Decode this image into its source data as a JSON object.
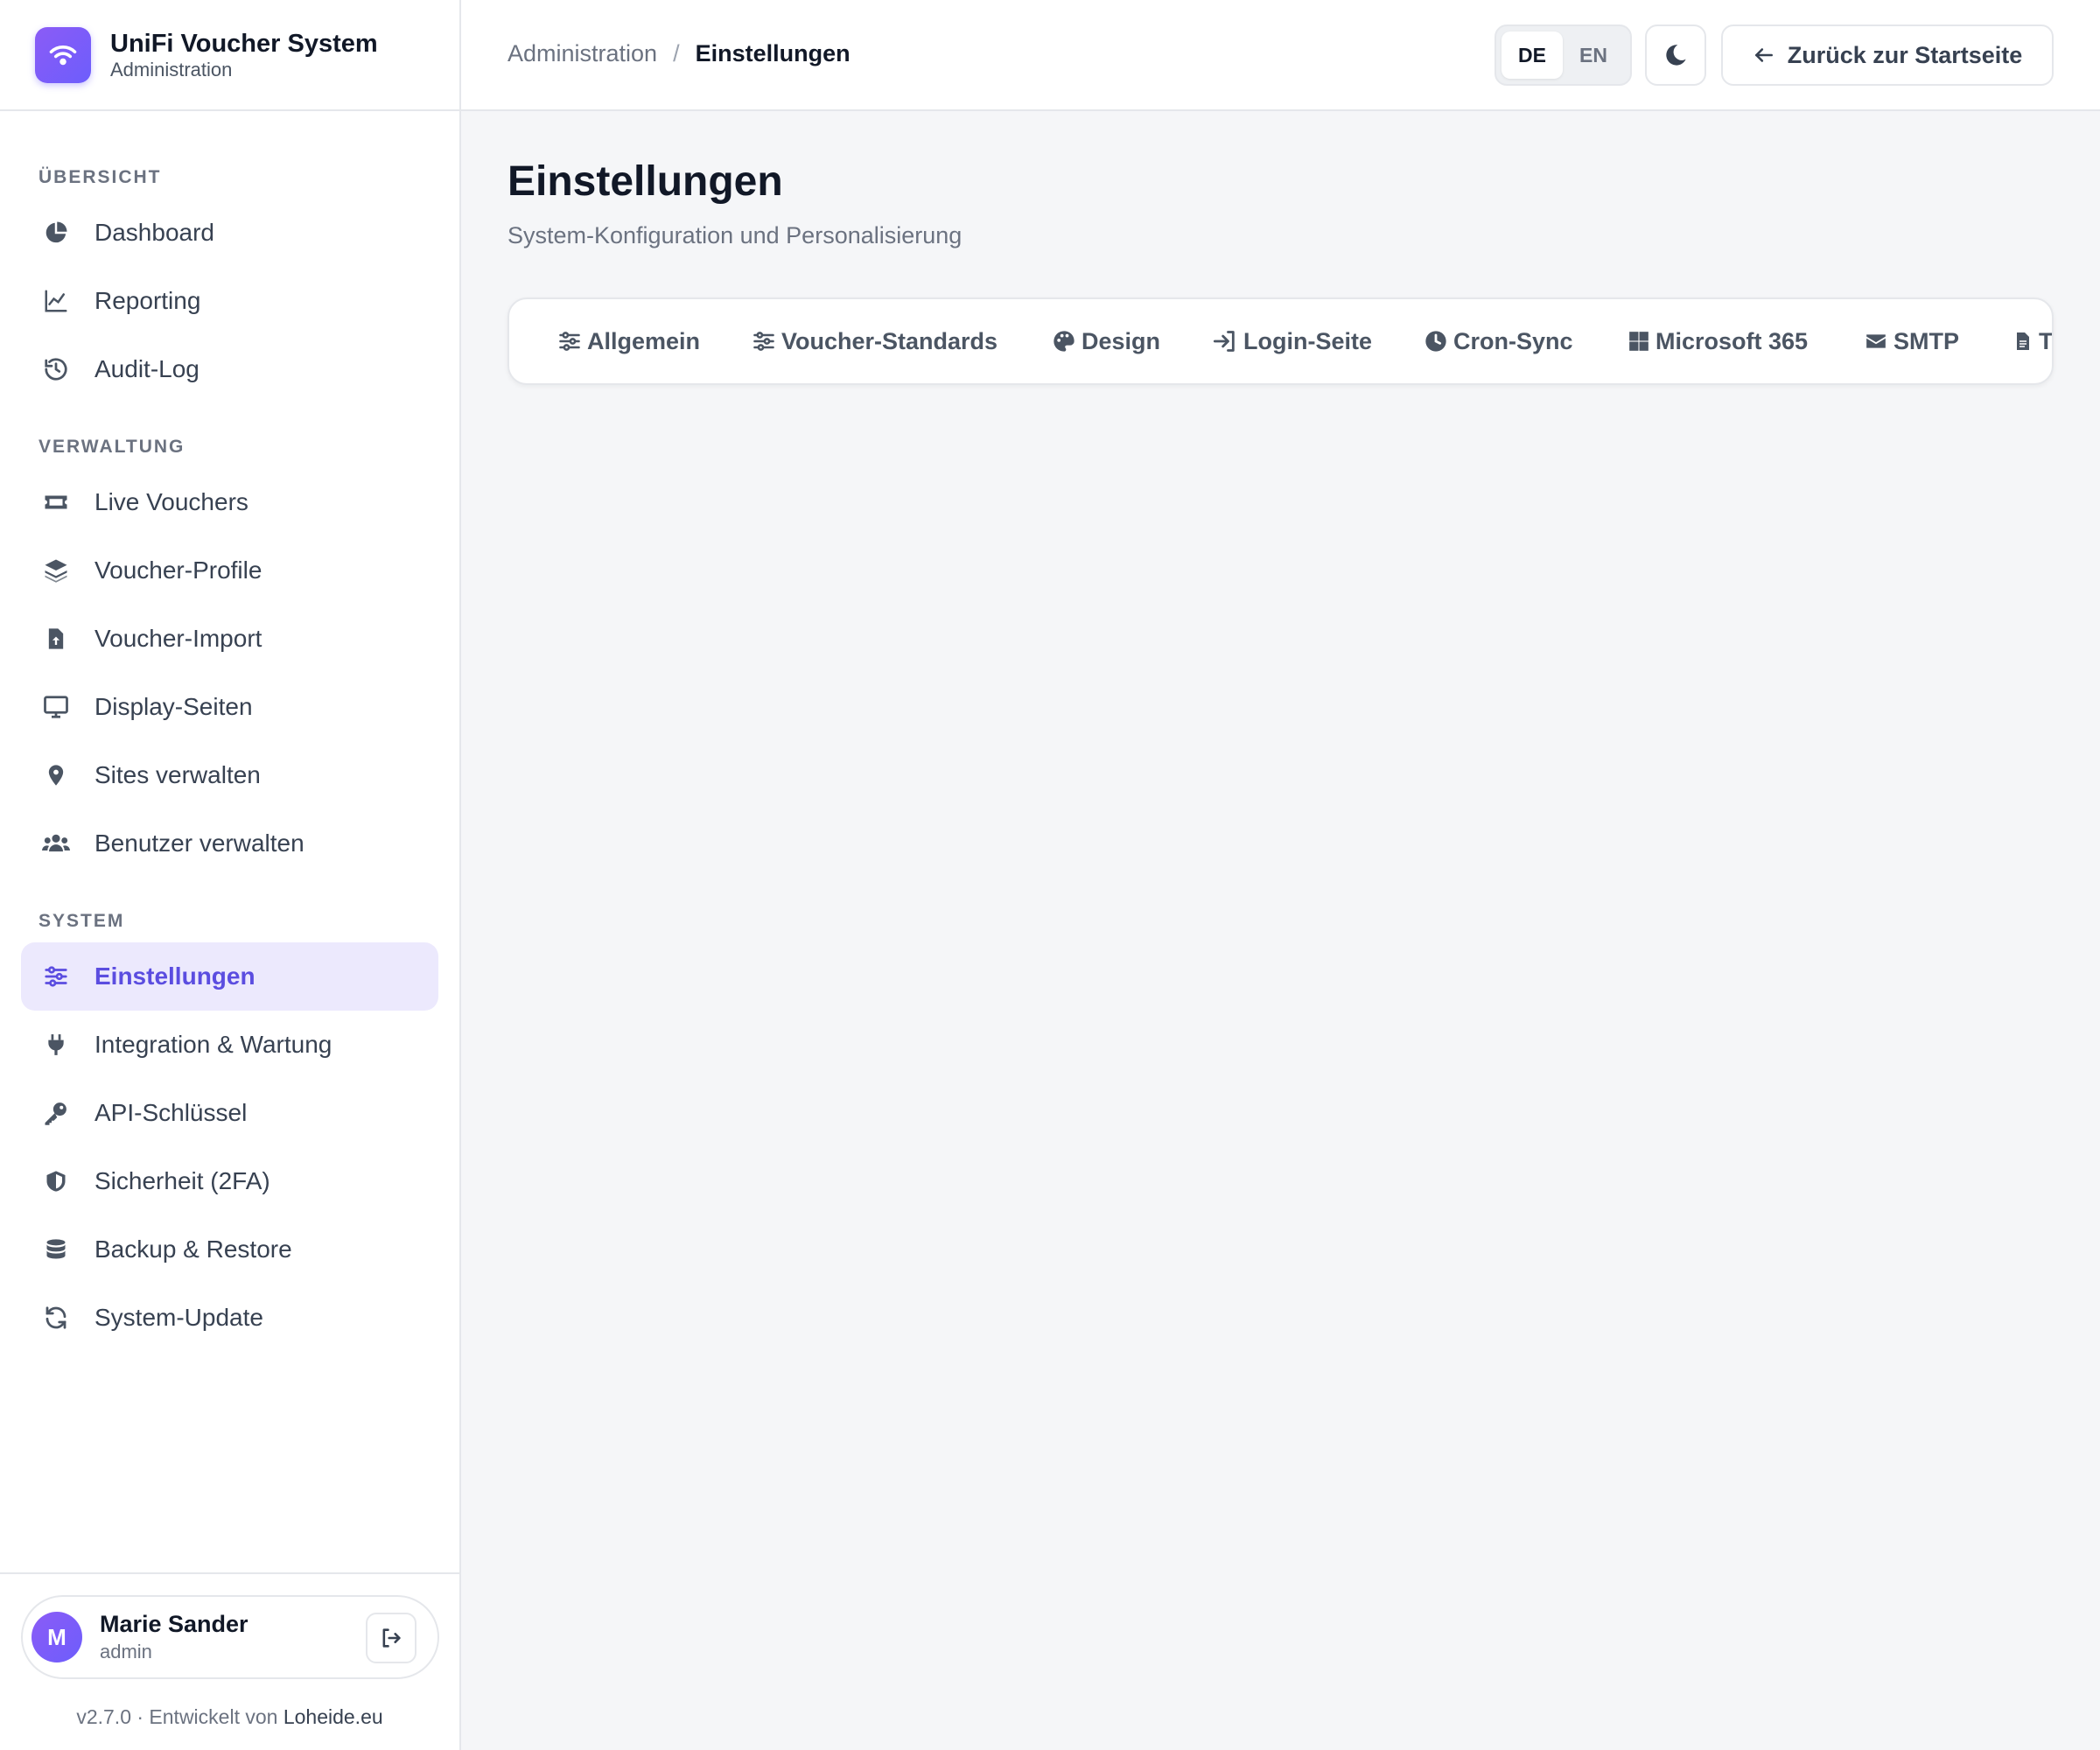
{
  "brand": {
    "title": "UniFi Voucher System",
    "subtitle": "Administration"
  },
  "sidebar": {
    "sections": [
      {
        "label": "ÜBERSICHT",
        "items": [
          "Dashboard",
          "Reporting",
          "Audit-Log"
        ]
      },
      {
        "label": "VERWALTUNG",
        "items": [
          "Live Vouchers",
          "Voucher-Profile",
          "Voucher-Import",
          "Display-Seiten",
          "Sites verwalten",
          "Benutzer verwalten"
        ]
      },
      {
        "label": "SYSTEM",
        "items": [
          "Einstellungen",
          "Integration & Wartung",
          "API-Schlüssel",
          "Sicherheit (2FA)",
          "Backup & Restore",
          "System-Update"
        ]
      }
    ],
    "active_item": "Einstellungen"
  },
  "user": {
    "initial": "M",
    "name": "Marie Sander",
    "role": "admin"
  },
  "footer": {
    "version_text": "v2.7.0 · Entwickelt von ",
    "link": "Loheide.eu"
  },
  "topbar": {
    "breadcrumb_parent": "Administration",
    "breadcrumb_sep": "/",
    "breadcrumb_current": "Einstellungen",
    "lang_de": "DE",
    "lang_en": "EN",
    "back_label": "Zurück zur Startseite"
  },
  "page": {
    "title": "Einstellungen",
    "subtitle": "System-Konfiguration und Personalisierung"
  },
  "tabs": [
    "Allgemein",
    "Voucher-Standards",
    "Design",
    "Login-Seite",
    "Cron-Sync",
    "Microsoft 365",
    "SMTP",
    "Te"
  ],
  "colors": {
    "accent": "#5b4de0",
    "active_bg": "#ece9fd",
    "background": "#f5f6f8"
  }
}
